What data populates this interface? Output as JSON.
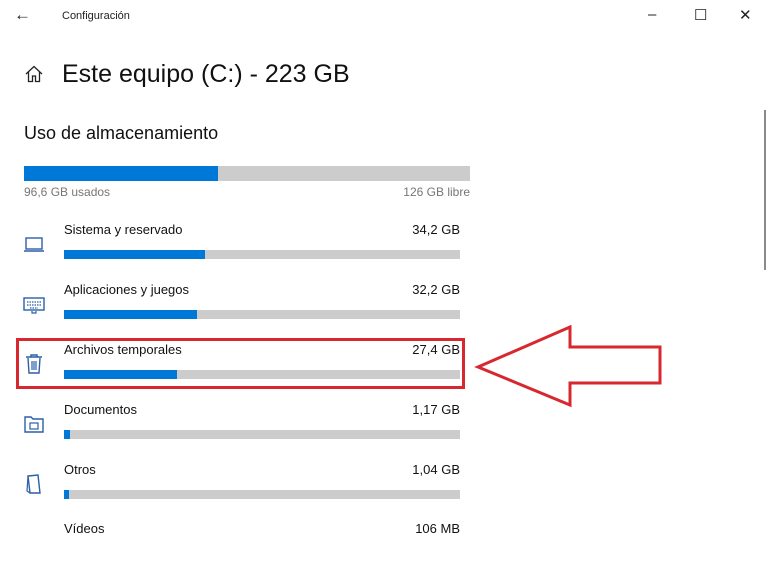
{
  "window": {
    "back_glyph": "←",
    "title": "Configuración",
    "minimize_glyph": "–",
    "maximize_glyph": "☐",
    "close_glyph": "✕"
  },
  "header": {
    "title": "Este equipo (C:) - 223 GB",
    "icon": "home-icon"
  },
  "usage": {
    "section_title": "Uso de almacenamiento",
    "used": "96,6 GB usados",
    "free": "126 GB libre",
    "used_fraction": 0.434
  },
  "categories": [
    {
      "name": "Sistema y reservado",
      "size": "34,2 GB",
      "fraction": 0.355,
      "icon": "laptop-icon"
    },
    {
      "name": "Aplicaciones y juegos",
      "size": "32,2 GB",
      "fraction": 0.335,
      "icon": "keyboard-icon"
    },
    {
      "name": "Archivos temporales",
      "size": "27,4 GB",
      "fraction": 0.285,
      "icon": "trash-icon"
    },
    {
      "name": "Documentos",
      "size": "1,17 GB",
      "fraction": 0.015,
      "icon": "folder-icon"
    },
    {
      "name": "Otros",
      "size": "1,04 GB",
      "fraction": 0.013,
      "icon": "document-icon"
    },
    {
      "name": "Vídeos",
      "size": "106 MB",
      "fraction": 0.005,
      "icon": "video-icon"
    }
  ],
  "colors": {
    "accent": "#0078d7",
    "bar_track": "#cccccc",
    "annotation": "#d7282f"
  }
}
